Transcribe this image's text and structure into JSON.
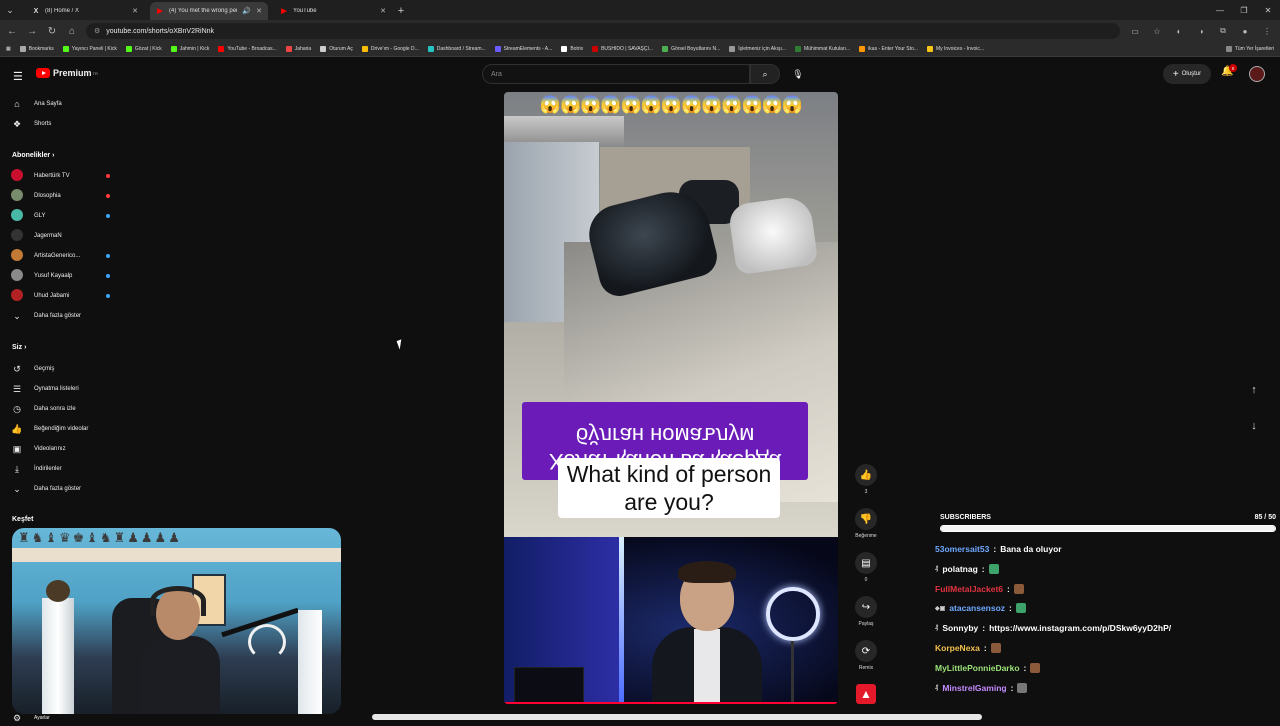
{
  "browser": {
    "tabs": [
      {
        "title": "(8) Home / X",
        "favicon": "x-logo",
        "active": false
      },
      {
        "title": "(4) You met the wrong pers",
        "favicon": "youtube-logo",
        "active": true
      },
      {
        "title": "YouTube",
        "favicon": "youtube-logo",
        "active": false
      }
    ],
    "url": "youtube.com/shorts/oXBnV2RiNnk",
    "bookmarks": [
      "Bookmarks",
      "Yayıncı Paneli | Kick",
      "Gözat | Kick",
      "Jahmin | Kick",
      "YouTube - Broadcas...",
      "Jaharia",
      "Oturum Aç",
      "Drive'ım - Google D...",
      "Dashboard / Stream...",
      "StreamElements - A...",
      "Botrix",
      "BUSHIDO | SAVAŞÇI...",
      "Görsel Boyutlarını N...",
      "İşletmeniz için Akışı...",
      "Mühimmat Kutuları...",
      "ikas - Enter Your Sto...",
      "My Invoices - Invoic..."
    ],
    "bookmarks_all": "Tüm Yer İşaretleri"
  },
  "yt": {
    "logo_text": "Premium",
    "logo_sup": "TR",
    "search_placeholder": "Ara",
    "create_label": "Oluştur",
    "notif_count": "9",
    "accent": "#ff0000"
  },
  "sidebar": {
    "home": "Ana Sayfa",
    "shorts": "Shorts",
    "subs_header": "Abonelikler",
    "subs": [
      {
        "name": "Habertürk TV",
        "color": "#c8102e",
        "dot": "#ff3a3a"
      },
      {
        "name": "Dlosophia",
        "color": "#7a8c6e",
        "dot": "#ff3a3a"
      },
      {
        "name": "GLY",
        "color": "#48b9a6",
        "dot": "#3ea6ff"
      },
      {
        "name": "JagermaN",
        "color": "#333333",
        "dot": ""
      },
      {
        "name": "ArtistaGenerico...",
        "color": "#c27a35",
        "dot": "#3ea6ff"
      },
      {
        "name": "Yusuf Kayaalp",
        "color": "#8a8a8a",
        "dot": "#3ea6ff"
      },
      {
        "name": "Uhud Jabami",
        "color": "#b22222",
        "dot": "#3ea6ff"
      }
    ],
    "show_more": "Daha fazla göster",
    "you_header": "Siz",
    "you": [
      {
        "label": "Geçmiş",
        "icon": "history-icon",
        "glyph": "↺"
      },
      {
        "label": "Oynatma listeleri",
        "icon": "playlist-icon",
        "glyph": "☰"
      },
      {
        "label": "Daha sonra izle",
        "icon": "clock-icon",
        "glyph": "◷"
      },
      {
        "label": "Beğendiğim videolar",
        "icon": "thumb-up-icon",
        "glyph": "👍"
      },
      {
        "label": "Videolarınız",
        "icon": "video-icon",
        "glyph": "▣"
      },
      {
        "label": "İndirilenler",
        "icon": "download-icon",
        "glyph": "⤓"
      }
    ],
    "show_more2": "Daha fazla göster",
    "explore_header": "Keşfet",
    "settings": "Ayarlar"
  },
  "short": {
    "emojis": "😱😱😱😱😱😱😱😱😱😱😱😱😱",
    "caption_cyrillic_1": "Холат қанон ва қаерда",
    "caption_cyrillic_2": "бўлган номаълум",
    "caption_en_1": "What kind of person",
    "caption_en_2": "are you?"
  },
  "actions": {
    "likes": "3",
    "dislike_label": "Beğenme",
    "comments": "0",
    "share_label": "Paylaş",
    "remix_label": "Remix"
  },
  "overlay": {
    "subs_label": "SUBSCRIBERS",
    "subs_count": "85 / 50",
    "subs_progress": 1.0,
    "chat": [
      {
        "user": "53omersait53",
        "color": "#6fa8ff",
        "text": "Bana da oluyor",
        "badge": "",
        "emote": ""
      },
      {
        "user": "polatnag",
        "color": "#ffffff",
        "text": "",
        "badge": "₰",
        "emote": "#3ea36a"
      },
      {
        "user": "FullMetalJacket6",
        "color": "#e1333f",
        "text": "",
        "badge": "",
        "emote": "#8a5a3a"
      },
      {
        "user": "atacansensoz",
        "color": "#6fa8ff",
        "text": "",
        "badge": "◆▣",
        "emote": "#3ea36a"
      },
      {
        "user": "Sonnyby",
        "color": "#ffffff",
        "text": "https://www.instagram.com/p/DSkw6yyD2hP/",
        "badge": "₰",
        "emote": ""
      },
      {
        "user": "KorpeNexa",
        "color": "#f2c14e",
        "text": "",
        "badge": "",
        "emote": "#8a5a3a"
      },
      {
        "user": "MyLittlePonnieDarko",
        "color": "#9be27a",
        "text": "",
        "badge": "",
        "emote": "#8a5a3a"
      },
      {
        "user": "MinstrelGaming",
        "color": "#c58bff",
        "text": "",
        "badge": "₰",
        "emote": "#777777"
      }
    ]
  }
}
